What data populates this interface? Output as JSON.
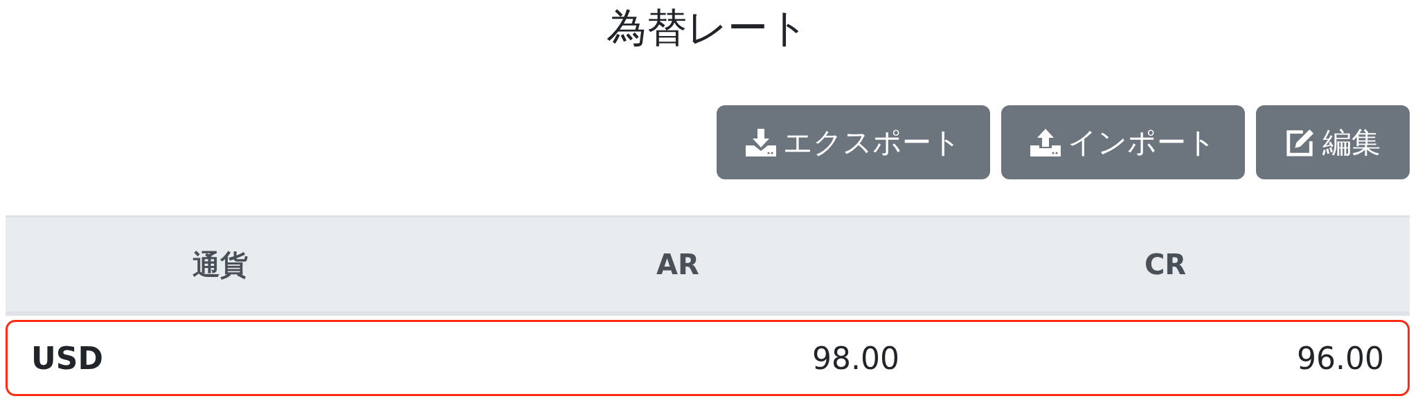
{
  "title": "為替レート",
  "buttons": [
    {
      "kind": "export",
      "label": "エクスポート"
    },
    {
      "kind": "import",
      "label": "インポート"
    },
    {
      "kind": "edit",
      "label": "編集"
    }
  ],
  "table": {
    "columns": [
      "通貨",
      "AR",
      "CR"
    ],
    "rows": [
      {
        "selected": true,
        "cells": [
          "USD",
          "98.00",
          "96.00"
        ]
      }
    ]
  }
}
